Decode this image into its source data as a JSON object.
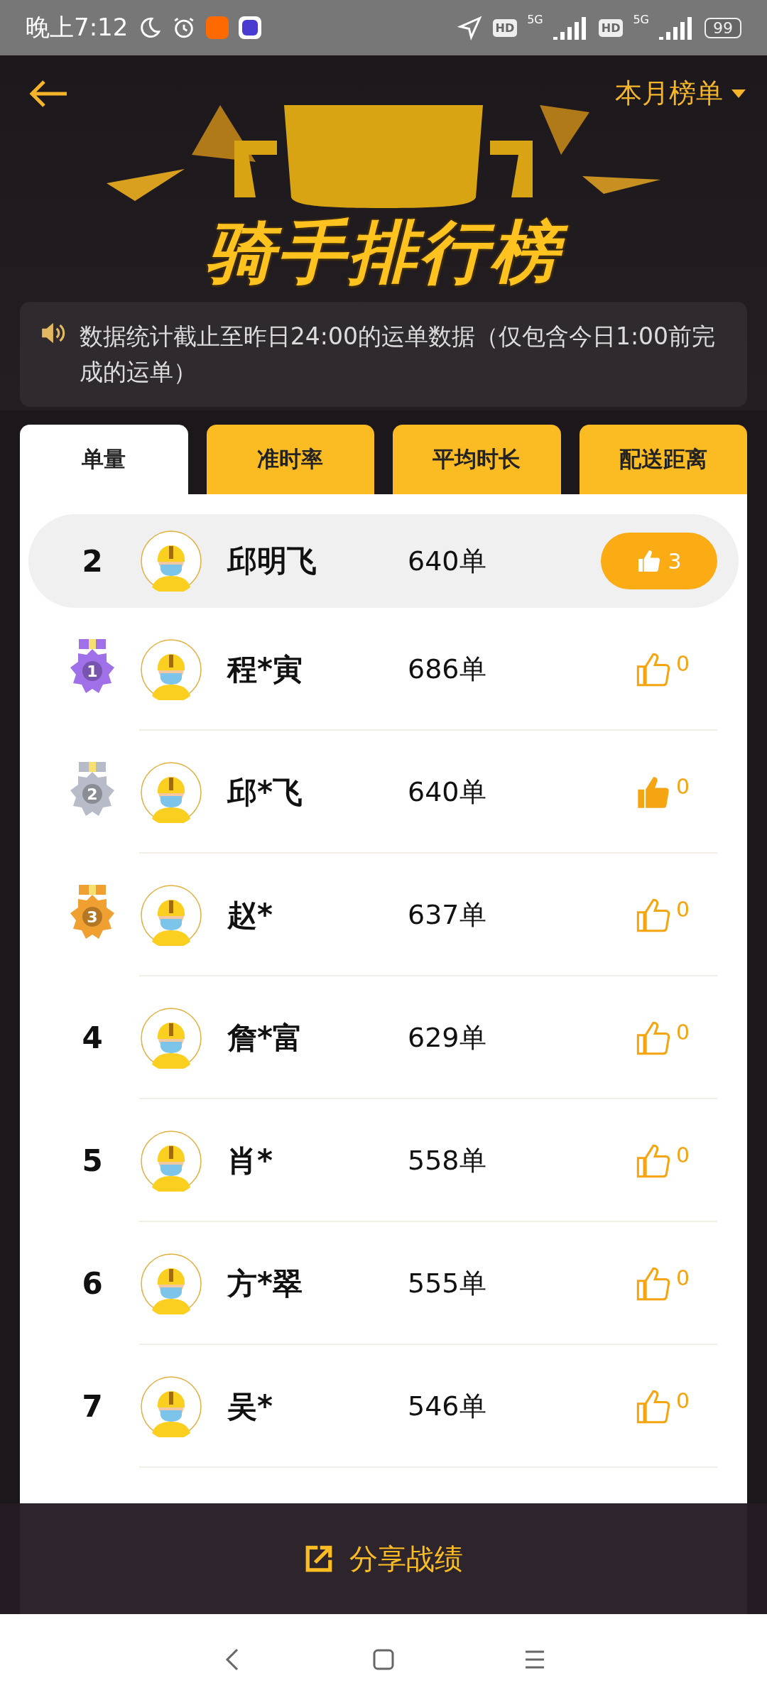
{
  "status_bar": {
    "time": "晚上7:12",
    "networks": [
      {
        "badge": "HD",
        "type": "5G"
      },
      {
        "badge": "HD",
        "type": "5G"
      }
    ],
    "battery": "99"
  },
  "header": {
    "period": "本月榜单",
    "title": "骑手排行榜"
  },
  "notice": "数据统计截止至昨日24:00的运单数据（仅包含今日1:00前完成的运单）",
  "tabs": [
    {
      "label": "单量",
      "selected": true
    },
    {
      "label": "准时率",
      "selected": false
    },
    {
      "label": "平均时长",
      "selected": false
    },
    {
      "label": "配送距离",
      "selected": false
    }
  ],
  "my_row": {
    "rank": "2",
    "name": "邱明飞",
    "count": "640单",
    "likes": "3"
  },
  "rows": [
    {
      "kind": "medal",
      "rank": "1",
      "color": "#a070e8",
      "name": "程*寅",
      "count": "686单",
      "likes": "0",
      "liked": false
    },
    {
      "kind": "medal",
      "rank": "2",
      "color": "#b8bcc8",
      "name": "邱*飞",
      "count": "640单",
      "likes": "0",
      "liked": true
    },
    {
      "kind": "medal",
      "rank": "3",
      "color": "#f0a030",
      "name": "赵*",
      "count": "637单",
      "likes": "0",
      "liked": false
    },
    {
      "kind": "number",
      "rank": "4",
      "name": "詹*富",
      "count": "629单",
      "likes": "0",
      "liked": false
    },
    {
      "kind": "number",
      "rank": "5",
      "name": "肖*",
      "count": "558单",
      "likes": "0",
      "liked": false
    },
    {
      "kind": "number",
      "rank": "6",
      "name": "方*翠",
      "count": "555单",
      "likes": "0",
      "liked": false
    },
    {
      "kind": "number",
      "rank": "7",
      "name": "吴*",
      "count": "546单",
      "likes": "0",
      "liked": false
    }
  ],
  "share_button": "分享战绩"
}
